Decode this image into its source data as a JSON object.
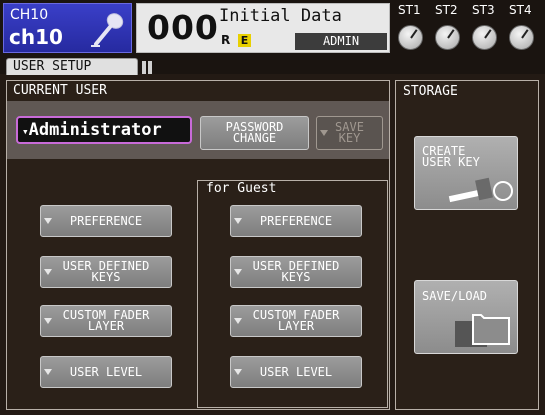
{
  "header": {
    "channel_id": "CH10",
    "channel_short": "ch10",
    "scene_number": "000",
    "scene_title": "Initial Data",
    "scene_r_flag": "R",
    "scene_e_flag": "E",
    "user_name": "ADMIN",
    "icons": {
      "microphone": "microphone-icon",
      "edit_flag": "edit-flag-icon"
    },
    "st_in": [
      {
        "label": "ST1"
      },
      {
        "label": "ST2"
      },
      {
        "label": "ST3"
      },
      {
        "label": "ST4"
      }
    ]
  },
  "tabs": [
    {
      "label": "USER SETUP"
    }
  ],
  "current_user": {
    "title": "CURRENT USER",
    "user_select": "Administrator",
    "password_change_label": "PASSWORD\nCHANGE",
    "save_key_label": "SAVE\nKEY",
    "buttons": [
      {
        "label": "PREFERENCE"
      },
      {
        "label": "USER DEFINED\nKEYS"
      },
      {
        "label": "CUSTOM FADER\nLAYER"
      },
      {
        "label": "USER LEVEL"
      }
    ]
  },
  "guest": {
    "title": "for Guest",
    "buttons": [
      {
        "label": "PREFERENCE"
      },
      {
        "label": "USER DEFINED\nKEYS"
      },
      {
        "label": "CUSTOM FADER\nLAYER"
      },
      {
        "label": "USER LEVEL"
      }
    ]
  },
  "storage": {
    "title": "STORAGE",
    "create_key_label": "CREATE\nUSER KEY",
    "save_load_label": "SAVE/LOAD",
    "icons": {
      "key": "user-key-icon",
      "folder": "folder-icon"
    }
  },
  "colors": {
    "channel_bg": "#2a2ea8",
    "dropdown_border": "#c86ad8",
    "panel_bg": "#2a2018",
    "button_bg": "#8c8c8c"
  }
}
